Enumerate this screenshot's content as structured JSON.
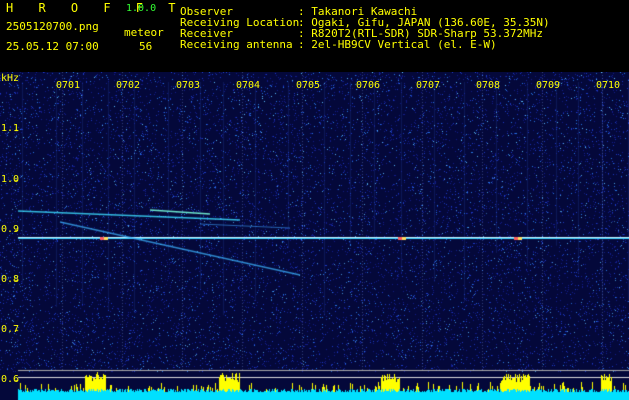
{
  "app": {
    "name": "H R O F F T",
    "version": "1.0.0"
  },
  "file": {
    "name": "2505120700.png",
    "datetime": "25.05.12 07:00"
  },
  "meteor": {
    "label": "meteor",
    "count": "56"
  },
  "info": [
    {
      "label": "Observer",
      "value": ": Takanori Kawachi"
    },
    {
      "label": "Receiving Location",
      "value": ": Ogaki, Gifu, JAPAN (136.60E, 35.35N)"
    },
    {
      "label": "Receiver",
      "value": ": R820T2(RTL-SDR) SDR-Sharp 53.372MHz"
    },
    {
      "label": "Receiving antenna",
      "value": ": 2el-HB9CV Vertical (el. E-W)"
    }
  ],
  "time_ticks": [
    "0701",
    "0702",
    "0703",
    "0704",
    "0705",
    "0706",
    "0707",
    "0708",
    "0709",
    "0710"
  ],
  "freq_unit": "kHz",
  "freq_ticks": [
    "1.1",
    "1.0",
    "0.9",
    "0.8",
    "0.7",
    "0.6"
  ],
  "colors": {
    "text": "#ffff00",
    "version": "#33ff33",
    "baseline": "#00ffff",
    "peaks": "#ffff00",
    "background": "#04083a"
  }
}
